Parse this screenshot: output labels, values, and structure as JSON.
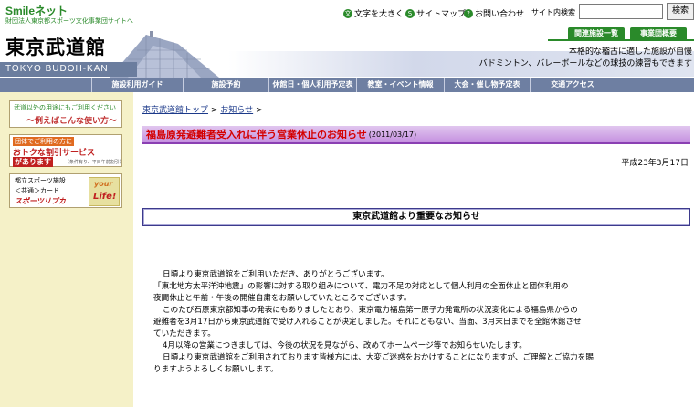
{
  "topbar": {
    "logo": "Smileネット",
    "logo_sub": "財団法人東京都スポーツ文化事業団サイトへ",
    "links": [
      {
        "icon": "text-size-icon",
        "glyph": "文",
        "label": "文字を大きく"
      },
      {
        "icon": "sitemap-icon",
        "glyph": "S",
        "label": "サイトマップ"
      },
      {
        "icon": "contact-icon",
        "glyph": "?",
        "label": "お問い合わせ"
      }
    ],
    "search_label": "サイト内検索",
    "search_value": "",
    "search_button": "検索"
  },
  "header": {
    "title": "東京武道館",
    "title_en": "TOKYO BUDOH-KAN",
    "tabs": [
      "関連施設一覧",
      "事業団概要"
    ],
    "tagline_1": "本格的な稽古に適した施設が自慢",
    "tagline_2": "バドミントン、バレーボールなどの球技の練習もできます"
  },
  "nav": {
    "items": [
      {
        "label": "施設利用ガイド"
      },
      {
        "label": "施設予約"
      },
      {
        "label": "休館日・個人利用予定表"
      },
      {
        "label": "教室・イベント情報"
      },
      {
        "label": "大会・催し物予定表"
      },
      {
        "label": "交通アクセス"
      }
    ]
  },
  "sidebar": {
    "usage_banner": {
      "line1": "武道以外の用途にもご利用ください",
      "line2": "～例えばこんな使い方～"
    },
    "discount_banner": {
      "line1": "団体でご利用の方に",
      "line2": "おトクな割引サービス",
      "line3": "があります",
      "line4": "（条件有り、平日午前割引）"
    },
    "card_banner": {
      "line1": "都立スポーツ施設",
      "line2": "＜共通＞カード",
      "line3": "スポーツリプカ",
      "your": "your",
      "life": "Life!"
    }
  },
  "main": {
    "breadcrumb": {
      "home": "東京武道館トップ",
      "sep": ">",
      "news": "お知らせ",
      "sep2": ">"
    },
    "news_title": "福島原発避難者受入れに伴う営業休止のお知らせ",
    "news_date": "(2011/03/17)",
    "doc_date": "平成23年3月17日",
    "notice_heading": "東京武道館より重要なお知らせ",
    "body": [
      "日頃より東京武道館をご利用いただき、ありがとうございます。",
      "「東北地方太平洋沖地震」の影響に対する取り組みについて、電力不足の対応として個人利用の全面休止と団体利用の",
      "夜間休止と午前・午後の開催自粛をお願いしていたところでございます。",
      "このたび石原東京都知事の発表にもありましたとおり、東京電力福島第一原子力発電所の状況変化による福島県からの",
      "避難者を3月17日から東京武道館で受け入れることが決定しました。それにともない、当面、3月末日までを全館休館させ",
      "ていただきます。",
      "4月以降の営業につきましては、今後の状況を見ながら、改めてホームページ等でお知らせいたします。",
      "日頃より東京武道館をご利用されております皆様方には、大変ご迷惑をおかけすることになりますが、ご理解とご協力を賜",
      "りますようよろしくお願いします。"
    ]
  },
  "colors": {
    "green": "#2a8a2a",
    "nav": "#6e7fa2",
    "sidebar": "#f5f1c8",
    "title_red": "#d40000",
    "title_bar": "#c590e0"
  }
}
